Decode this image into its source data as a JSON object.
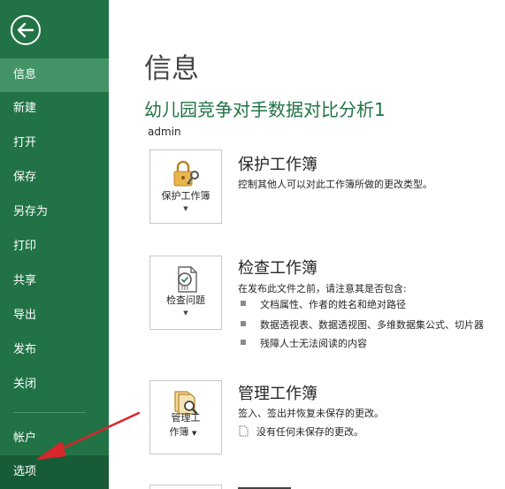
{
  "sidebar": {
    "items": [
      {
        "label": "信息"
      },
      {
        "label": "新建"
      },
      {
        "label": "打开"
      },
      {
        "label": "保存"
      },
      {
        "label": "另存为"
      },
      {
        "label": "打印"
      },
      {
        "label": "共享"
      },
      {
        "label": "导出"
      },
      {
        "label": "发布"
      },
      {
        "label": "关闭"
      },
      {
        "label": "帐户"
      },
      {
        "label": "选项"
      }
    ]
  },
  "main": {
    "page_title": "信息",
    "doc_title": "幼儿园竞争对手数据对比分析1",
    "author": "admin",
    "sections": [
      {
        "button_label": "保护工作簿",
        "heading": "保护工作簿",
        "description": "控制其他人可以对此工作簿所做的更改类型。",
        "icon": "lock-key-icon"
      },
      {
        "button_label": "检查问题",
        "heading": "检查工作簿",
        "description": "在发布此文件之前，请注意其是否包含:",
        "bullets": [
          "文档属性、作者的姓名和绝对路径",
          "数据透视表、数据透视图、多维数据集公式、切片器",
          "残障人士无法阅读的内容"
        ],
        "icon": "inspect-document-icon"
      },
      {
        "button_label_line1": "管理工",
        "button_label_line2": "作簿",
        "heading": "管理工作簿",
        "description": "签入、签出并恢复未保存的更改。",
        "note": "没有任何未保存的更改。",
        "icon": "manage-workbook-icon"
      }
    ]
  },
  "colors": {
    "sidebar": "#217346",
    "sidebar_active": "#439467",
    "accent_title": "#217346",
    "annotation_arrow": "#d9262a"
  }
}
